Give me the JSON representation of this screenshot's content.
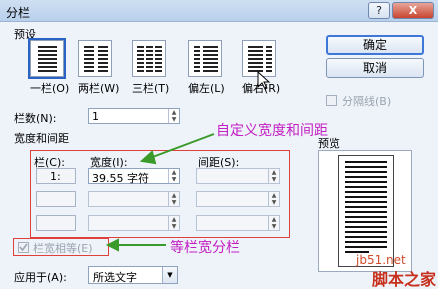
{
  "window": {
    "title": "分栏",
    "help_label": "?",
    "close_label": "X"
  },
  "presets": {
    "label": "预设",
    "items": [
      "一栏(O)",
      "两栏(W)",
      "三栏(T)",
      "偏左(L)",
      "偏右(R)"
    ]
  },
  "buttons": {
    "ok": "确定",
    "cancel": "取消"
  },
  "separator_label": "分隔线(B)",
  "num_columns": {
    "label": "栏数(N):",
    "value": "1"
  },
  "width_spacing": {
    "label": "宽度和间距",
    "col_header": "栏(C):",
    "width_header": "宽度(I):",
    "spacing_header": "间距(S):",
    "row1_col": "1:",
    "row1_width": "39.55 字符"
  },
  "preview_label": "预览",
  "equal_width_label": "栏宽相等(E)",
  "apply_to": {
    "label": "应用于(A):",
    "value": "所选文字"
  },
  "annotations": {
    "custom": "自定义宽度和间距",
    "equal": "等栏宽分栏"
  },
  "watermark": {
    "site": "jb51.net",
    "name": "脚本之家"
  },
  "colors": {
    "annotation": "#c21ec2",
    "red_box": "#e0403a",
    "arrow": "#3a9a2a"
  }
}
